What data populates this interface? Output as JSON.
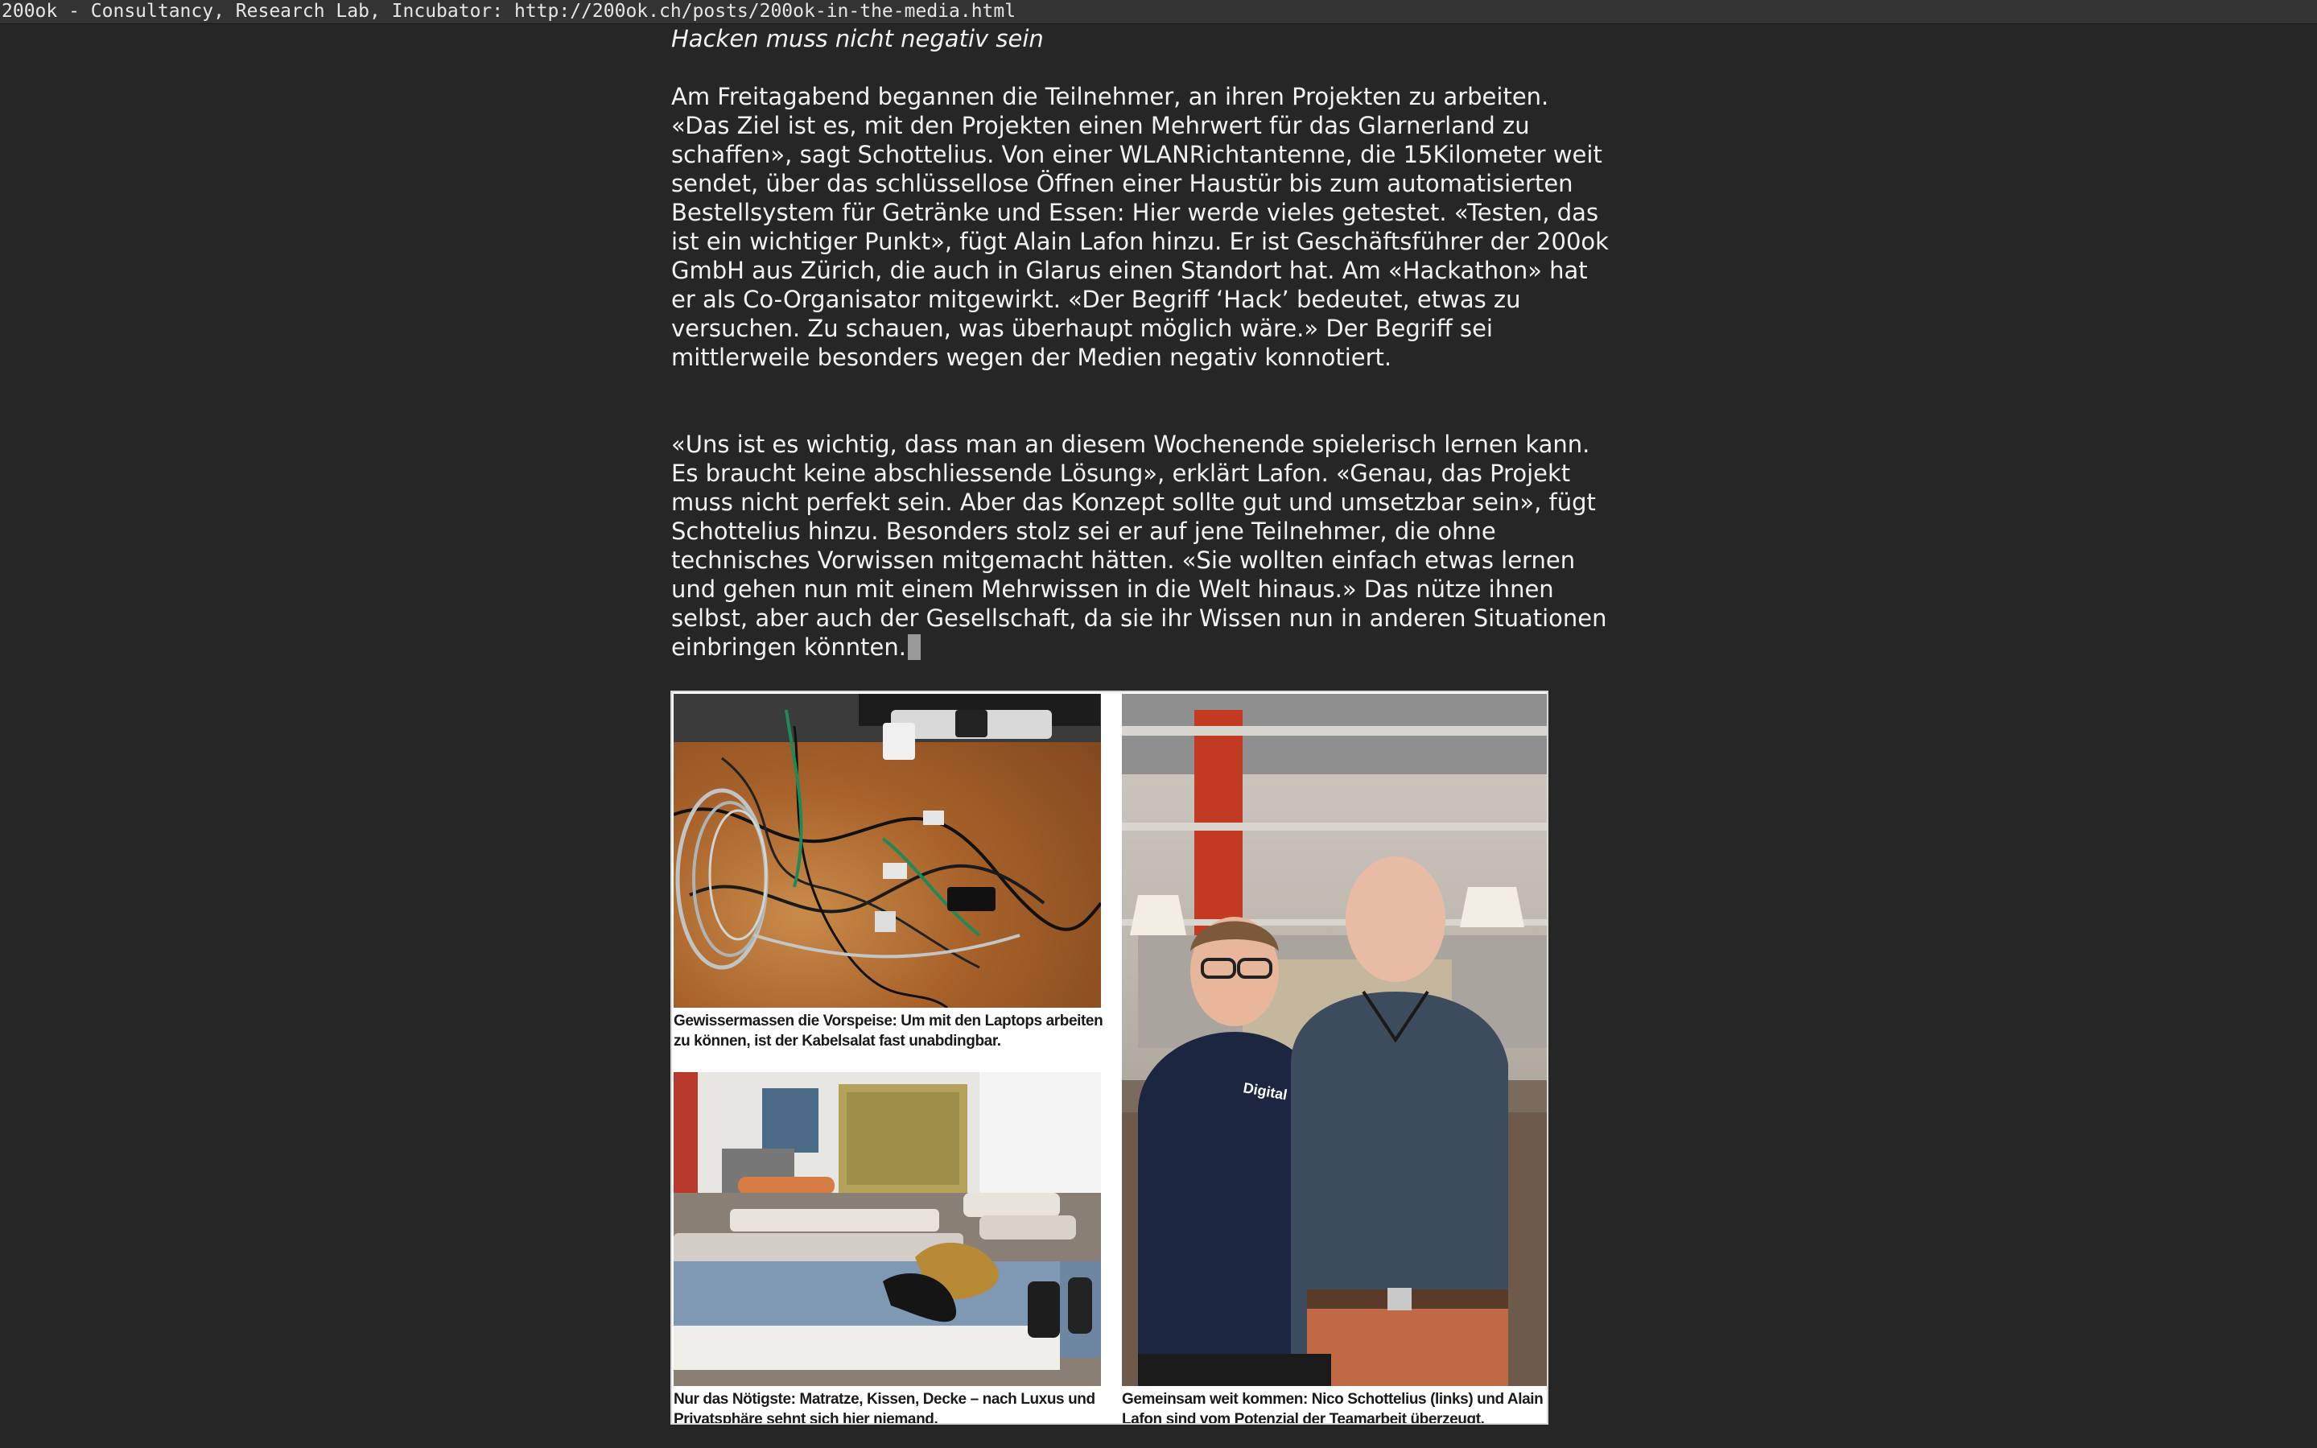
{
  "window": {
    "title": "200ok - Consultancy, Research Lab, Incubator: http://200ok.ch/posts/200ok-in-the-media.html"
  },
  "article": {
    "subheading": "Hacken muss nicht negativ sein",
    "paragraph_1": "Am Freitagabend begannen die Teilnehmer, an ihren Projekten zu arbeiten. «Das Ziel ist es, mit den Projekten einen Mehrwert für das Glarnerland zu schaffen», sagt Schottelius. Von einer WLANRichtantenne, die 15Kilometer weit sendet, über das schlüssellose Öffnen einer Haustür bis zum automatisierten Bestellsystem für Getränke und Essen: Hier werde vieles getestet. «Testen, das ist ein wichtiger Punkt», fügt Alain Lafon hinzu. Er ist Geschäftsführer der 200ok GmbH aus Zürich, die auch in Glarus einen Standort hat. Am «Hackathon» hat er als Co-Organisator mitgewirkt. «Der Begriff ‘Hack’ bedeutet, etwas zu versuchen. Zu schauen, was überhaupt möglich wäre.» Der Begriff sei mittlerweile besonders wegen der Medien negativ konnotiert.",
    "paragraph_2": "«Uns ist es wichtig, dass man an diesem Wochenende spielerisch lernen kann. Es braucht keine abschliessende Lösung», erklärt Lafon. «Genau, das Projekt muss nicht perfekt sein. Aber das Konzept sollte gut und umsetzbar sein», fügt Schottelius hinzu. Besonders stolz sei er auf jene Teilnehmer, die ohne technisches Vorwissen mitgemacht hätten. «Sie wollten einfach etwas lernen und gehen nun mit einem Mehrwissen in die Welt hinaus.» Das nütze ihnen selbst, aber auch der Gesellschaft, da sie ihr Wissen nun in anderen Situationen einbringen könnten."
  },
  "figure": {
    "caption_cables": "Gewissermassen die Vorspeise: Um mit den Laptops arbeiten zu können, ist der Kabelsalat fast unabdingbar.",
    "caption_beds": "Nur das Nötigste: Matratze, Kissen, Decke – nach Luxus und Privatsphäre sehnt sich hier niemand.",
    "caption_people": "Gemeinsam weit kommen: Nico Schottelius (links) und Alain Lafon sind vom Potenzial der Teamarbeit überzeugt.",
    "shirt_print": "Digital Glarus"
  }
}
